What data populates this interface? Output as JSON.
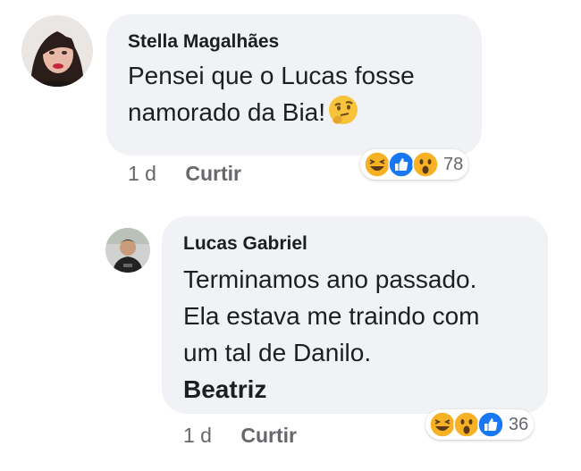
{
  "comments": [
    {
      "author": "Stella Magalhães",
      "lines": [
        "Pensei que o Lucas fosse",
        "namorado da Bia!"
      ],
      "trailing_emoji": "thinking-face-emoji",
      "time": "1 d",
      "like_label": "Curtir",
      "reactions": [
        "haha",
        "like",
        "wow"
      ],
      "reaction_count": "78"
    },
    {
      "author": "Lucas Gabriel",
      "lines": [
        "Terminamos ano passado.",
        "Ela estava me traindo com",
        "um tal de Danilo."
      ],
      "mention": "Beatriz",
      "time": "1 d",
      "like_label": "Curtir",
      "reactions": [
        "haha",
        "wow",
        "like"
      ],
      "reaction_count": "36"
    }
  ],
  "colors": {
    "bubble": "#f0f2f5",
    "text": "#1c1e21",
    "meta": "#65676b",
    "like_blue": "#1877f2",
    "emoji_yellow": "#f7b125"
  }
}
